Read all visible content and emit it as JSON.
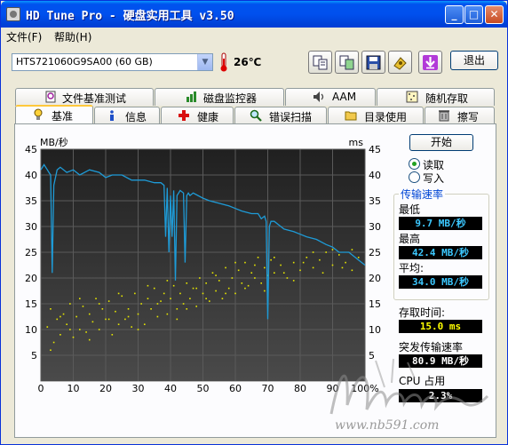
{
  "window": {
    "title": "HD Tune Pro - 硬盘实用工具 v3.50",
    "min_glyph": "_",
    "max_glyph": "□",
    "close_glyph": "✕"
  },
  "menu": {
    "file": "文件(F)",
    "help": "帮助(H)"
  },
  "toolbar": {
    "drive": "HTS721060G9SA00 (60 GB)",
    "temperature": "26℃",
    "exit_label": "退出",
    "icons": [
      "copy-text-icon",
      "copy-screen-icon",
      "save-icon",
      "options-icon",
      "download-icon"
    ]
  },
  "tabs_top": [
    {
      "label": "文件基准测试",
      "icon": "file-benchmark-icon"
    },
    {
      "label": "磁盘监控器",
      "icon": "disk-monitor-icon"
    },
    {
      "label": "AAM",
      "icon": "aam-icon"
    },
    {
      "label": "随机存取",
      "icon": "random-access-icon"
    }
  ],
  "tabs_bottom": [
    {
      "label": "基准",
      "icon": "benchmark-icon",
      "active": true
    },
    {
      "label": "信息",
      "icon": "info-icon"
    },
    {
      "label": "健康",
      "icon": "health-icon"
    },
    {
      "label": "错误扫描",
      "icon": "error-scan-icon"
    },
    {
      "label": "目录使用",
      "icon": "folder-usage-icon"
    },
    {
      "label": "擦写",
      "icon": "erase-icon"
    }
  ],
  "controls": {
    "start_label": "开始",
    "read_label": "读取",
    "write_label": "写入",
    "mode": "read"
  },
  "results": {
    "transfer_title": "传输速率",
    "min_label": "最低",
    "min_value": "9.7 MB/秒",
    "max_label": "最高",
    "max_value": "42.4 MB/秒",
    "avg_label": "平均:",
    "avg_value": "34.0 MB/秒",
    "access_label": "存取时间:",
    "access_value": "15.0 ms",
    "burst_label": "突发传输速率",
    "burst_value": "80.9 MB/秒",
    "cpu_label": "CPU 占用",
    "cpu_value": "2.3%"
  },
  "watermark": {
    "text": "www.nb591.com",
    "signature": "Monne"
  },
  "colors": {
    "chart_bg": "#000000",
    "grid": "#5a5a5a",
    "transfer_line": "#1e9bd7",
    "access_dots": "#e6e600",
    "title_bar": "#0050ee"
  },
  "chart_data": {
    "type": "line",
    "ylabel_left": "MB/秒",
    "ylabel_right": "ms",
    "xlim": [
      0,
      100
    ],
    "ylim": [
      0,
      45
    ],
    "x_ticks": [
      "0",
      "10",
      "20",
      "30",
      "40",
      "50",
      "60",
      "70",
      "80",
      "90",
      "100%"
    ],
    "y_ticks_left": [
      "5",
      "10",
      "15",
      "20",
      "25",
      "30",
      "35",
      "40",
      "45"
    ],
    "y_ticks_right": [
      "5",
      "10",
      "15",
      "20",
      "25",
      "30",
      "35",
      "40",
      "45"
    ],
    "grid": true,
    "series": [
      {
        "kind": "transfer-rate",
        "x": [
          0,
          1,
          2,
          2.5,
          3,
          3.5,
          4,
          5,
          6,
          8,
          10,
          12,
          15,
          18,
          20,
          22,
          25,
          28,
          30,
          32,
          35,
          37,
          38,
          38.5,
          39,
          39.5,
          40,
          40.5,
          41,
          41.5,
          42,
          43,
          44,
          44.5,
          45,
          45.5,
          46,
          47,
          50,
          52,
          55,
          58,
          60,
          62,
          65,
          67,
          68,
          69,
          69.5,
          70,
          70.5,
          71,
          72,
          75,
          78,
          80,
          82,
          85,
          88,
          90,
          92,
          95,
          98,
          100
        ],
        "y": [
          41,
          42,
          41,
          40.5,
          40,
          21,
          38,
          41,
          41.5,
          40.5,
          41,
          40,
          41,
          40.5,
          39.5,
          40,
          40,
          39,
          39,
          39,
          38.5,
          38.5,
          38,
          28,
          37.5,
          25,
          36,
          28,
          37,
          19.5,
          36,
          37,
          36.5,
          23,
          36,
          36.5,
          36,
          36.5,
          35.5,
          35,
          34.5,
          34,
          33.5,
          33,
          32.5,
          32.5,
          31.5,
          32,
          31,
          12,
          30,
          31,
          31,
          29.5,
          29,
          28.5,
          28,
          27.5,
          26.5,
          26,
          25,
          25,
          23.5,
          22.5
        ]
      },
      {
        "kind": "access-time",
        "points": [
          [
            2,
            10.5
          ],
          [
            3,
            14
          ],
          [
            4,
            7.5
          ],
          [
            5,
            12
          ],
          [
            6,
            9
          ],
          [
            7,
            13
          ],
          [
            8,
            11
          ],
          [
            9,
            15
          ],
          [
            10,
            8.5
          ],
          [
            11,
            12.5
          ],
          [
            12,
            10
          ],
          [
            13,
            14.5
          ],
          [
            14,
            9.5
          ],
          [
            15,
            13
          ],
          [
            16,
            11.5
          ],
          [
            17,
            16
          ],
          [
            18,
            10
          ],
          [
            19,
            14
          ],
          [
            20,
            12
          ],
          [
            21,
            15.5
          ],
          [
            22,
            9
          ],
          [
            23,
            13.5
          ],
          [
            24,
            11
          ],
          [
            25,
            16.5
          ],
          [
            26,
            12
          ],
          [
            27,
            14
          ],
          [
            28,
            10.5
          ],
          [
            29,
            17
          ],
          [
            30,
            13
          ],
          [
            31,
            15
          ],
          [
            32,
            11
          ],
          [
            33,
            16
          ],
          [
            34,
            14
          ],
          [
            35,
            18
          ],
          [
            36,
            12.5
          ],
          [
            37,
            15.5
          ],
          [
            38,
            17
          ],
          [
            39,
            13
          ],
          [
            40,
            16
          ],
          [
            41,
            18.5
          ],
          [
            42,
            14
          ],
          [
            43,
            17
          ],
          [
            44,
            15
          ],
          [
            45,
            19
          ],
          [
            46,
            16
          ],
          [
            47,
            18
          ],
          [
            48,
            14.5
          ],
          [
            49,
            20
          ],
          [
            50,
            17
          ],
          [
            51,
            19
          ],
          [
            52,
            15.5
          ],
          [
            53,
            21
          ],
          [
            54,
            17.5
          ],
          [
            55,
            19.5
          ],
          [
            56,
            16
          ],
          [
            57,
            22
          ],
          [
            58,
            18
          ],
          [
            59,
            20
          ],
          [
            60,
            17
          ],
          [
            61,
            21.5
          ],
          [
            62,
            19
          ],
          [
            63,
            23
          ],
          [
            64,
            18.5
          ],
          [
            65,
            21
          ],
          [
            66,
            20
          ],
          [
            67,
            24
          ],
          [
            68,
            19
          ],
          [
            69,
            22
          ],
          [
            70,
            20.5
          ],
          [
            71,
            23.5
          ],
          [
            72,
            21
          ],
          [
            74,
            22.5
          ],
          [
            76,
            20
          ],
          [
            78,
            23
          ],
          [
            80,
            21.5
          ],
          [
            82,
            24
          ],
          [
            84,
            22
          ],
          [
            86,
            23.5
          ],
          [
            88,
            25
          ],
          [
            90,
            22.5
          ],
          [
            92,
            24.5
          ],
          [
            94,
            23
          ],
          [
            96,
            25.5
          ],
          [
            98,
            24
          ],
          [
            3,
            6
          ],
          [
            6,
            12.5
          ],
          [
            9,
            10
          ],
          [
            12,
            16
          ],
          [
            15,
            8
          ],
          [
            18,
            15
          ],
          [
            21,
            12
          ],
          [
            24,
            17
          ],
          [
            27,
            12.5
          ],
          [
            30,
            10
          ],
          [
            33,
            18.5
          ],
          [
            36,
            15
          ],
          [
            39,
            19.5
          ],
          [
            42,
            12
          ],
          [
            45,
            14
          ],
          [
            48,
            18
          ],
          [
            51,
            16
          ],
          [
            54,
            20.5
          ],
          [
            57,
            17
          ],
          [
            60,
            23
          ],
          [
            63,
            18
          ],
          [
            66,
            22.5
          ],
          [
            69,
            17.5
          ],
          [
            72,
            24
          ],
          [
            75,
            21
          ],
          [
            78,
            19.5
          ],
          [
            81,
            23
          ],
          [
            84,
            25
          ],
          [
            87,
            21
          ],
          [
            90,
            25.5
          ],
          [
            93,
            22
          ],
          [
            96,
            21.5
          ]
        ]
      }
    ]
  }
}
